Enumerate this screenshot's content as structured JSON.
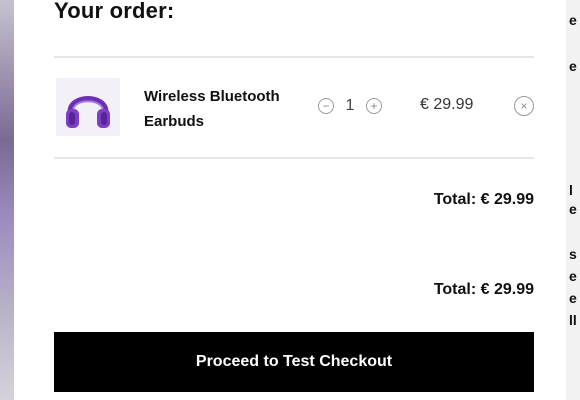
{
  "order": {
    "title": "Your order:",
    "item": {
      "name_line1": "Wireless Bluetooth",
      "name_line2": "Earbuds",
      "quantity": "1",
      "price": "€ 29.99",
      "thumbnail_icon": "headphones-icon",
      "thumbnail_color": "#7b3fc4"
    },
    "subtotal_text": "Total: € 29.99",
    "total_text": "Total: € 29.99",
    "checkout_label": "Proceed to Test Checkout"
  },
  "icons": {
    "minus": "−",
    "plus": "+",
    "remove": "×"
  },
  "background_fragments": [
    "e",
    "e",
    "l",
    "e",
    "s",
    "e",
    "e",
    "ll"
  ],
  "colors": {
    "modal_bg": "#ffffff",
    "button_bg": "#000000",
    "button_text": "#ffffff",
    "divider": "#e6e6e6"
  }
}
